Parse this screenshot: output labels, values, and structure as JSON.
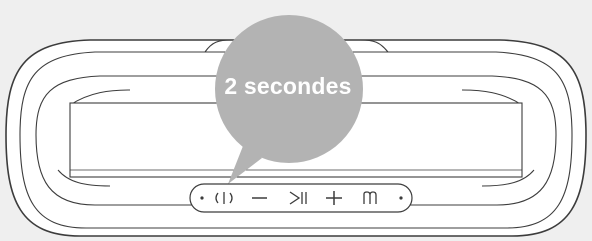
{
  "callout": {
    "text": "2 secondes"
  },
  "colors": {
    "background": "#efefef",
    "outline": "#3c3c3c",
    "bubble": "#b3b3b3",
    "bubble_text": "#ffffff"
  },
  "controls": [
    {
      "name": "bluetooth-pairing-button",
      "icon": "bluetooth-pairing-icon"
    },
    {
      "name": "volume-down-button",
      "icon": "minus-icon"
    },
    {
      "name": "play-pause-button",
      "icon": "play-pause-icon"
    },
    {
      "name": "volume-up-button",
      "icon": "plus-icon"
    },
    {
      "name": "power-mode-button",
      "icon": "mode-icon"
    }
  ]
}
